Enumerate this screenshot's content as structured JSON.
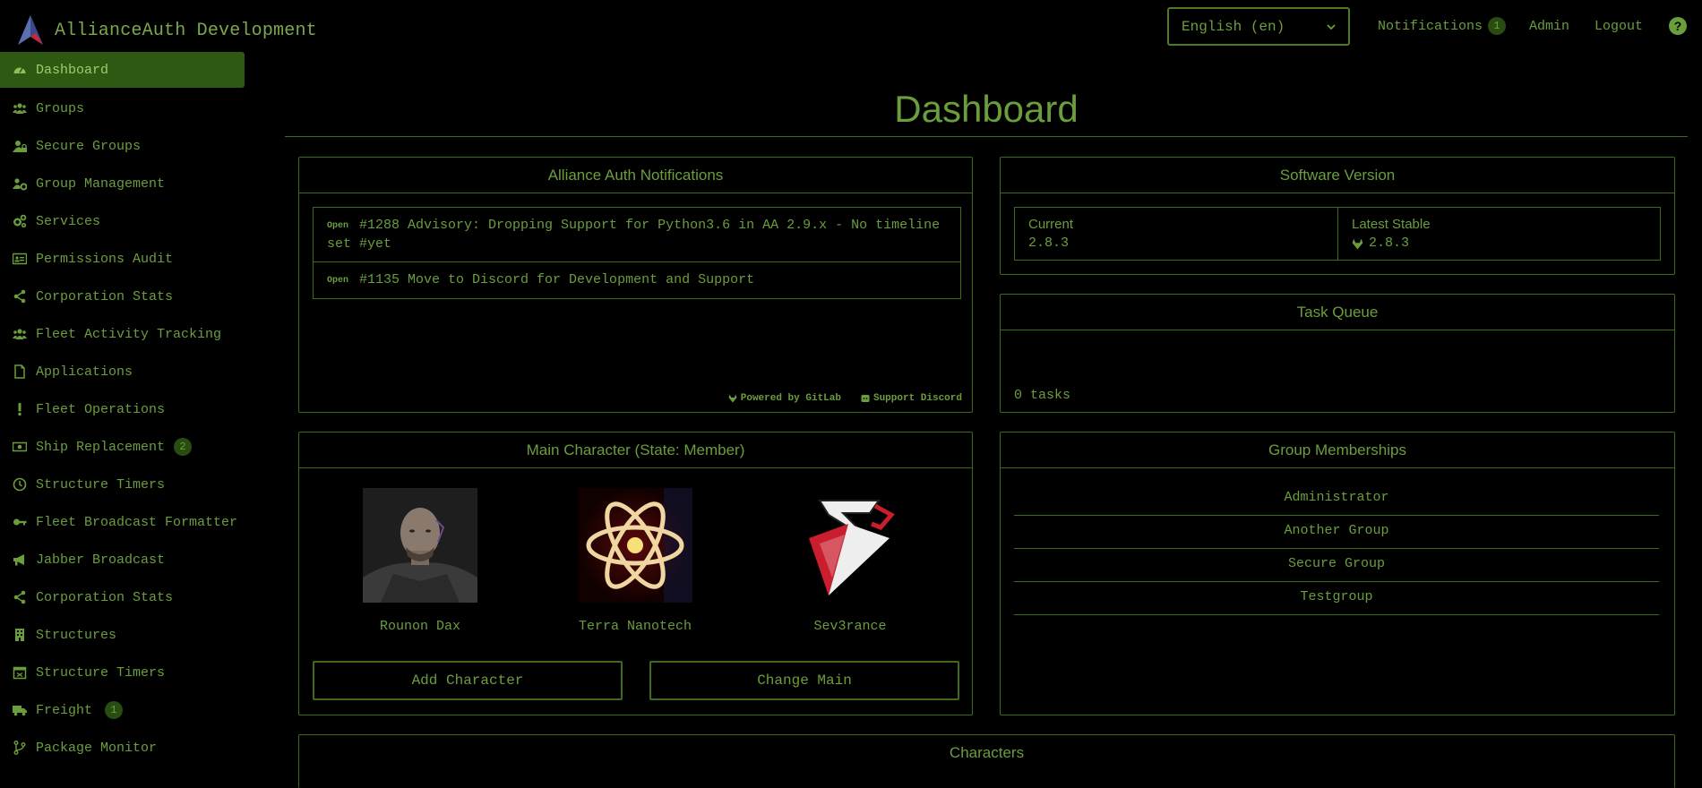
{
  "header": {
    "app_name": "AllianceAuth Development",
    "language_selected": "English (en)",
    "notifications_label": "Notifications",
    "notifications_count": "1",
    "admin_label": "Admin",
    "logout_label": "Logout"
  },
  "sidebar": {
    "items": [
      {
        "label": "Dashboard",
        "icon": "tachometer-icon"
      },
      {
        "label": "Groups",
        "icon": "users-icon"
      },
      {
        "label": "Secure Groups",
        "icon": "user-lock-icon"
      },
      {
        "label": "Group Management",
        "icon": "users-cog-icon"
      },
      {
        "label": "Services",
        "icon": "cogs-icon"
      },
      {
        "label": "Permissions Audit",
        "icon": "id-card-icon"
      },
      {
        "label": "Corporation Stats",
        "icon": "share-icon"
      },
      {
        "label": "Fleet Activity Tracking",
        "icon": "users-icon"
      },
      {
        "label": "Applications",
        "icon": "file-icon"
      },
      {
        "label": "Fleet Operations",
        "icon": "exclamation-icon"
      },
      {
        "label": "Ship Replacement",
        "icon": "money-bill-icon",
        "badge": "2"
      },
      {
        "label": "Structure Timers",
        "icon": "clock-icon"
      },
      {
        "label": "Fleet Broadcast Formatter",
        "icon": "key-icon"
      },
      {
        "label": "Jabber Broadcast",
        "icon": "bullhorn-icon"
      },
      {
        "label": "Corporation Stats",
        "icon": "share-icon"
      },
      {
        "label": "Structures",
        "icon": "building-icon"
      },
      {
        "label": "Structure Timers",
        "icon": "calendar-icon"
      },
      {
        "label": "Freight",
        "icon": "truck-icon",
        "badge": "1"
      },
      {
        "label": "Package Monitor",
        "icon": "code-branch-icon"
      }
    ]
  },
  "main": {
    "title": "Dashboard",
    "notifications_panel": {
      "title": "Alliance Auth Notifications",
      "items": [
        {
          "badge": "Open",
          "text": "#1288 Advisory: Dropping Support for Python3.6 in AA 2.9.x - No timeline set #yet"
        },
        {
          "badge": "Open",
          "text": "#1135 Move to Discord for Development and Support"
        }
      ],
      "powered_by": "Powered by GitLab",
      "support": "Support Discord"
    },
    "version_panel": {
      "title": "Software Version",
      "current_label": "Current",
      "current_value": "2.8.3",
      "latest_label": "Latest Stable",
      "latest_value": "2.8.3"
    },
    "task_queue": {
      "title": "Task Queue",
      "status": "0 tasks"
    },
    "main_character": {
      "title": "Main Character (State: Member)",
      "character_name": "Rounon Dax",
      "corporation_name": "Terra Nanotech",
      "alliance_name": "Sev3rance",
      "add_button": "Add Character",
      "change_button": "Change Main"
    },
    "group_memberships": {
      "title": "Group Memberships",
      "groups": [
        "Administrator",
        "Another Group",
        "Secure Group",
        "Testgroup"
      ]
    },
    "characters_panel": {
      "title": "Characters"
    }
  }
}
